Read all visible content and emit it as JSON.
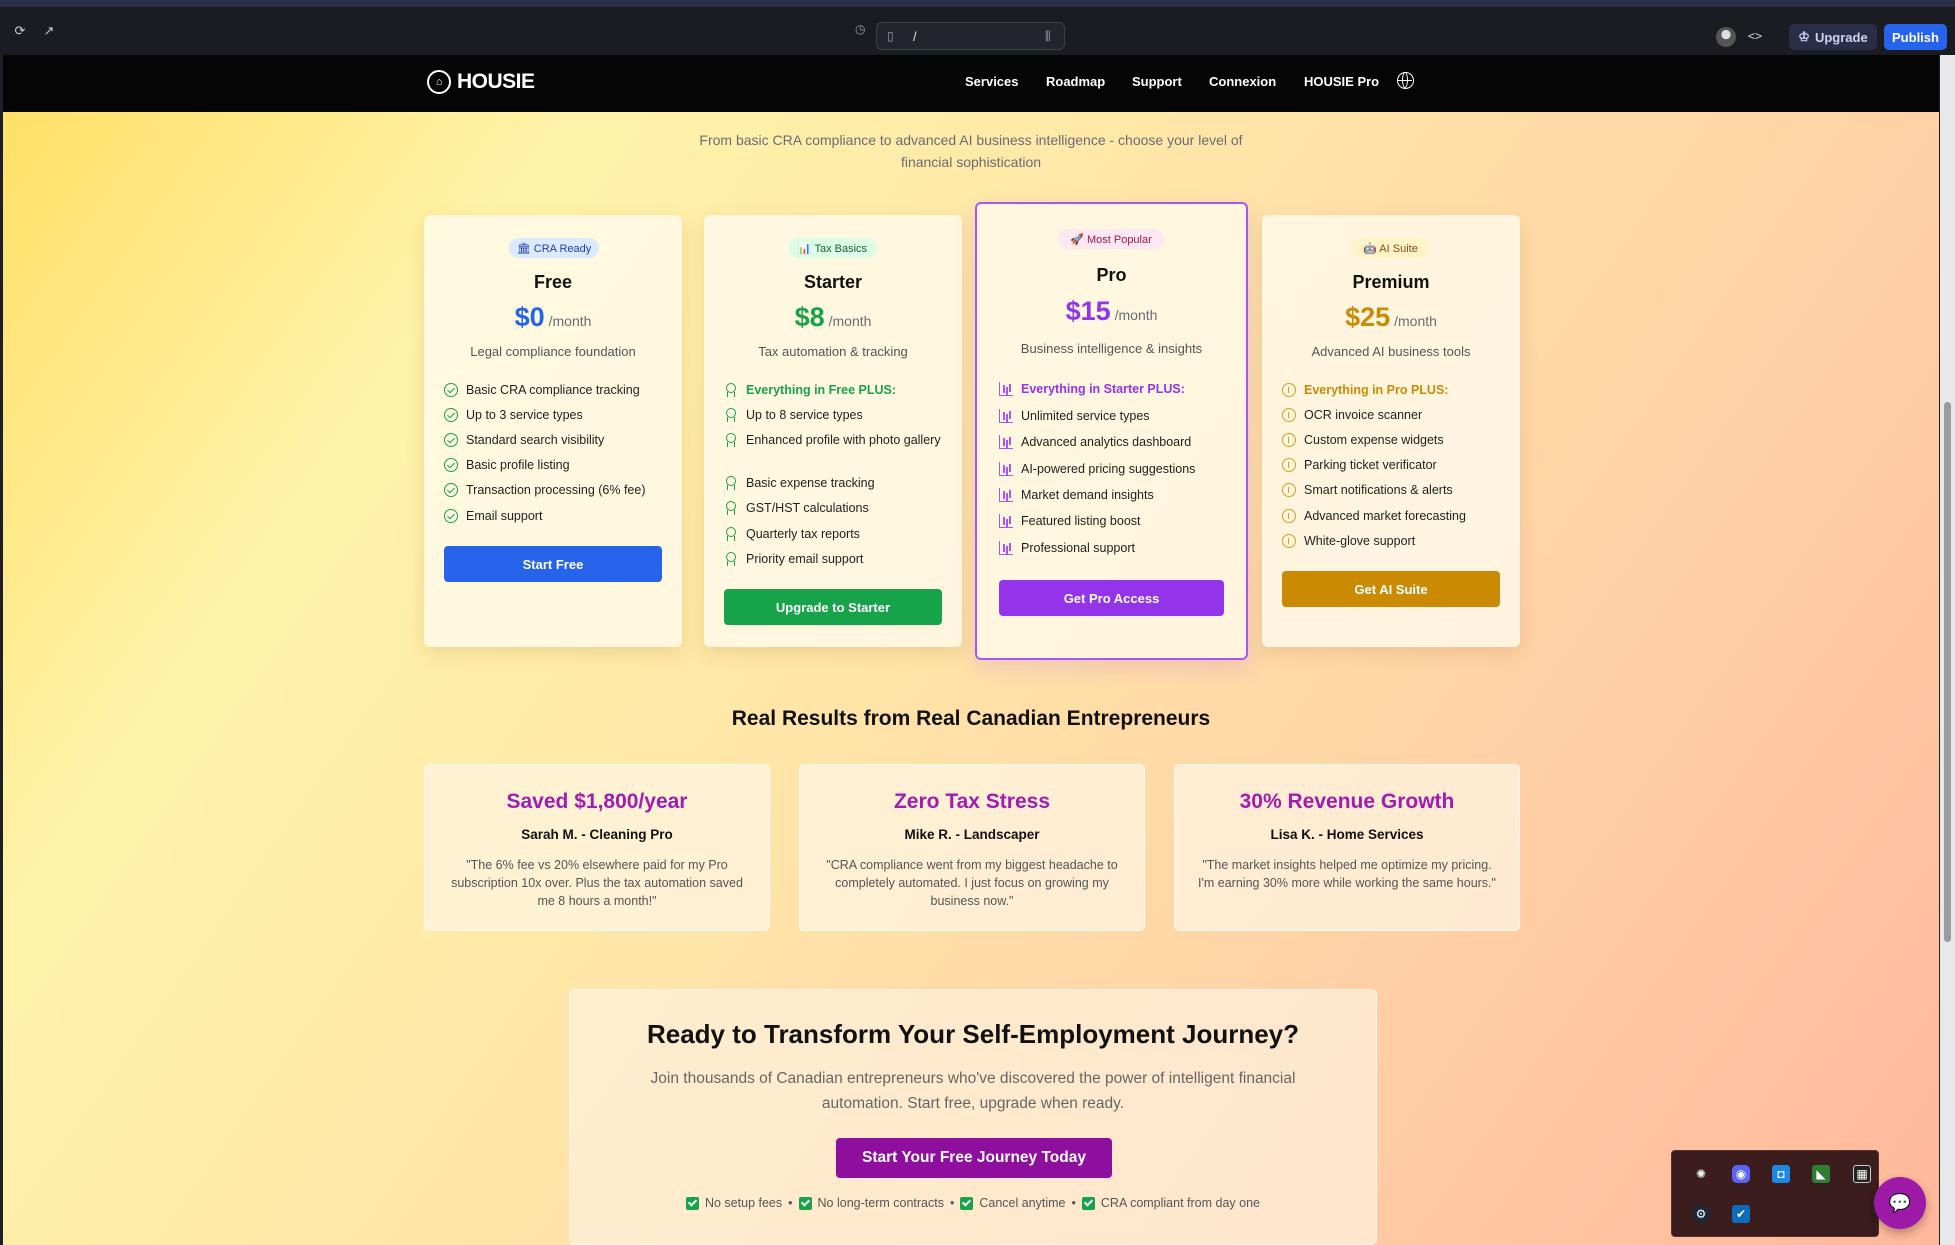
{
  "browser": {
    "url": "/",
    "upgrade_label": "Upgrade",
    "publish_label": "Publish"
  },
  "site": {
    "logo_text": "HOUSIE",
    "nav": [
      "Services",
      "Roadmap",
      "Support",
      "Connexion",
      "HOUSIE Pro"
    ]
  },
  "intro": {
    "subtitle_line1": "From basic CRA compliance to advanced AI business intelligence - choose your level of",
    "subtitle_line2": "financial sophistication"
  },
  "plans": [
    {
      "badge": "🏛 CRA Ready",
      "name": "Free",
      "price": "$0",
      "period": "/month",
      "tagline": "Legal compliance foundation",
      "features": [
        "Basic CRA compliance tracking",
        "Up to 3 service types",
        "Standard search visibility",
        "Basic profile listing",
        "Transaction processing (6% fee)",
        "Email support"
      ],
      "cta": "Start Free",
      "color": "#2563eb",
      "badge_bg": "#dbeafe",
      "badge_fg": "#1e40af"
    },
    {
      "badge": "📊 Tax Basics",
      "name": "Starter",
      "price": "$8",
      "period": "/month",
      "tagline": "Tax automation & tracking",
      "features": [
        "Everything in Free PLUS:",
        "Up to 8 service types",
        "Enhanced profile with photo gallery",
        "Basic expense tracking",
        "GST/HST calculations",
        "Quarterly tax reports",
        "Priority email support"
      ],
      "cta": "Upgrade to Starter",
      "color": "#16a34a",
      "badge_bg": "#dcfce7",
      "badge_fg": "#166534"
    },
    {
      "badge": "🚀 Most Popular",
      "name": "Pro",
      "price": "$15",
      "period": "/month",
      "tagline": "Business intelligence & insights",
      "features": [
        "Everything in Starter PLUS:",
        "Unlimited service types",
        "Advanced analytics dashboard",
        "AI-powered pricing suggestions",
        "Market demand insights",
        "Featured listing boost",
        "Professional support"
      ],
      "cta": "Get Pro Access",
      "color": "#9333ea",
      "badge_bg": "#fce7f3",
      "badge_fg": "#9d174d"
    },
    {
      "badge": "🤖 AI Suite",
      "name": "Premium",
      "price": "$25",
      "period": "/month",
      "tagline": "Advanced AI business tools",
      "features": [
        "Everything in Pro PLUS:",
        "OCR invoice scanner",
        "Custom expense widgets",
        "Parking ticket verificator",
        "Smart notifications & alerts",
        "Advanced market forecasting",
        "White-glove support"
      ],
      "cta": "Get AI Suite",
      "color": "#ca8a04",
      "badge_bg": "#fef3c7",
      "badge_fg": "#854d0e"
    }
  ],
  "results": {
    "title": "Real Results from Real Canadian Entrepreneurs",
    "items": [
      {
        "headline": "Saved $1,800/year",
        "who": "Sarah M. - Cleaning Pro",
        "quote": "\"The 6% fee vs 20% elsewhere paid for my Pro subscription 10x over. Plus the tax automation saved me 8 hours a month!\""
      },
      {
        "headline": "Zero Tax Stress",
        "who": "Mike R. - Landscaper",
        "quote": "\"CRA compliance went from my biggest headache to completely automated. I just focus on growing my business now.\""
      },
      {
        "headline": "30% Revenue Growth",
        "who": "Lisa K. - Home Services",
        "quote": "\"The market insights helped me optimize my pricing. I'm earning 30% more while working the same hours.\""
      }
    ]
  },
  "final_cta": {
    "title": "Ready to Transform Your Self-Employment Journey?",
    "text": "Join thousands of Canadian entrepreneurs who've discovered the power of intelligent financial automation. Start free, upgrade when ready.",
    "button": "Start Your Free Journey Today",
    "perks": [
      "No setup fees",
      "No long-term contracts",
      "Cancel anytime",
      "CRA compliant from day one"
    ],
    "separator": "•"
  }
}
